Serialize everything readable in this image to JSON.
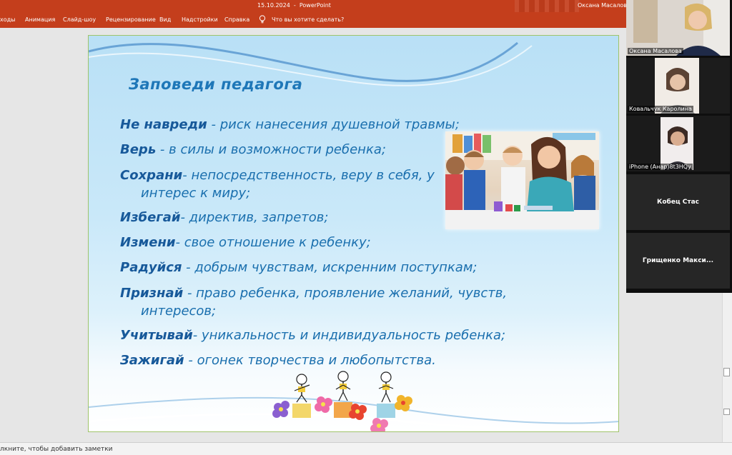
{
  "titlebar": {
    "document_title": "15.10.2024  -  PowerPoint",
    "user": "Оксана Масалова"
  },
  "ribbon": {
    "tabs": [
      "ходы",
      "Анимация",
      "Слайд-шоу",
      "Рецензирование",
      "Вид",
      "Надстройки",
      "Справка"
    ],
    "tell_me": "Что вы хотите сделать?"
  },
  "slide": {
    "title": "Заповеди педагога",
    "lines": [
      {
        "keyword": "Не навреди",
        "text": " - риск нанесения душевной травмы;"
      },
      {
        "keyword": "Верь",
        "text": " - в силы и возможности ребенка;"
      },
      {
        "keyword": "Сохрани",
        "text": "- непосредственность, веру в себя, у"
      },
      {
        "keyword": "",
        "text": "интерес к миру;"
      },
      {
        "keyword": "Избегай",
        "text": "- директив, запретов;"
      },
      {
        "keyword": "Измени",
        "text": "- свое отношение к ребенку;"
      },
      {
        "keyword": "Радуйся",
        "text": " - добрым чувствам, искренним поступкам;"
      },
      {
        "keyword": "Признай",
        "text": " - право ребенка, проявление желаний, чувств,"
      },
      {
        "keyword": "",
        "text": "интересов;"
      },
      {
        "keyword": "Учитывай",
        "text": "- уникальность и индивидуальность ребенка;"
      },
      {
        "keyword": "Зажигай",
        "text": " - огонек творчества и любопытства."
      }
    ]
  },
  "notes": {
    "placeholder": "лкните, чтобы добавить заметки"
  },
  "participants": [
    {
      "name": "Оксана Масалова",
      "video": true
    },
    {
      "name": "Ковальчук Каролина",
      "video": true
    },
    {
      "name": "iPhone (Анар)8t3HQy",
      "video": true
    },
    {
      "name": "Кобец Стас",
      "video": false
    },
    {
      "name": "Грищенко  Макси...",
      "video": false
    }
  ],
  "colors": {
    "ribbon": "#c43e1c",
    "slide_text": "#1a6fae",
    "slide_keyword": "#17599a"
  }
}
